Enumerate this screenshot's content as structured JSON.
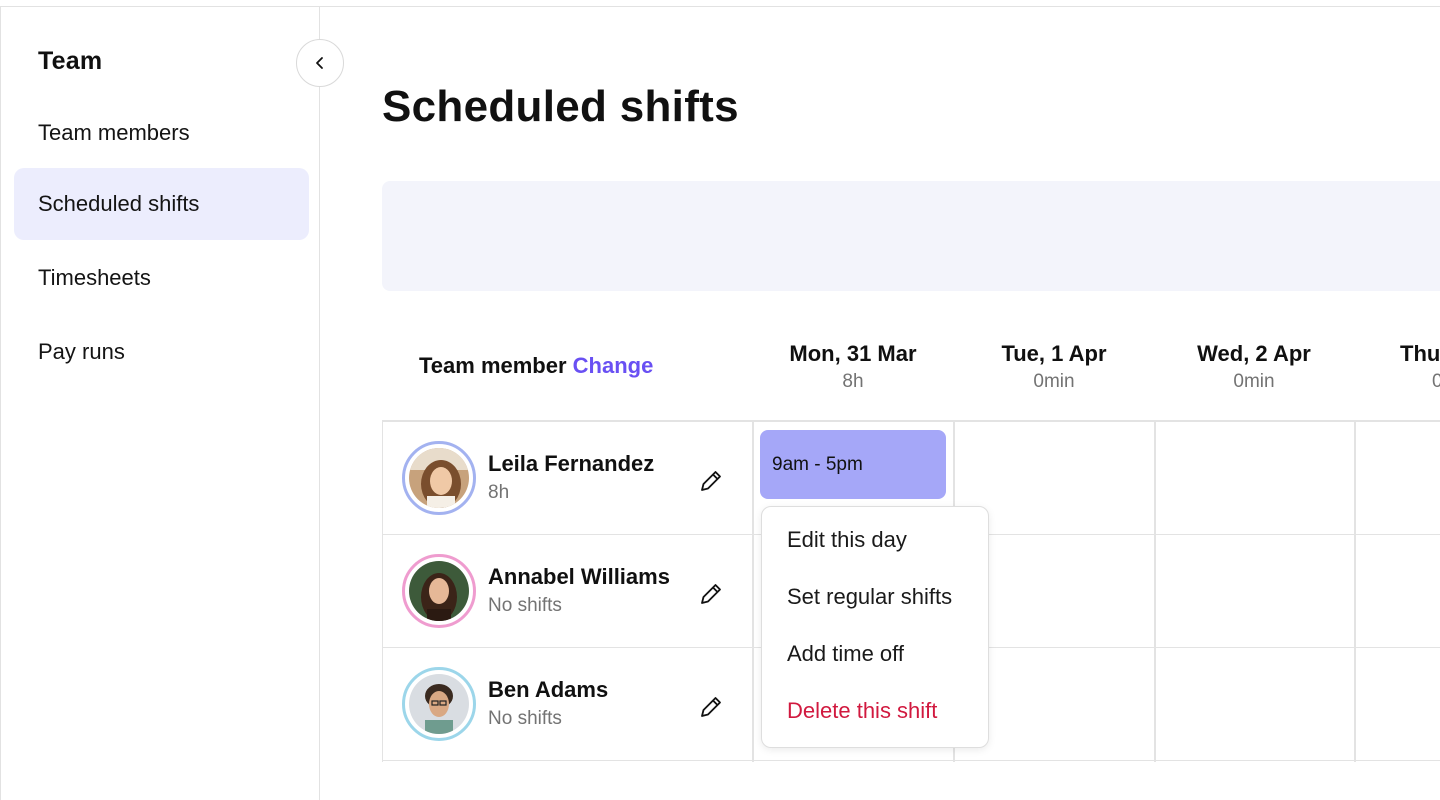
{
  "sidebar": {
    "title": "Team",
    "items": [
      {
        "label": "Team members",
        "active": false
      },
      {
        "label": "Scheduled shifts",
        "active": true
      },
      {
        "label": "Timesheets",
        "active": false
      },
      {
        "label": "Pay runs",
        "active": false
      }
    ],
    "collapse_icon": "chevron-left-icon"
  },
  "main": {
    "title": "Scheduled shifts",
    "grid": {
      "member_header": "Team member",
      "change_link": "Change",
      "days": [
        {
          "label": "Mon, 31 Mar",
          "hours": "8h"
        },
        {
          "label": "Tue, 1 Apr",
          "hours": "0min"
        },
        {
          "label": "Wed, 2 Apr",
          "hours": "0min"
        },
        {
          "label": "Thu",
          "hours": "0"
        }
      ],
      "members": [
        {
          "name": "Leila Fernandez",
          "sub": "8h",
          "ring_color": "#a3b2f0"
        },
        {
          "name": "Annabel Williams",
          "sub": "No shifts",
          "ring_color": "#ef9ccf"
        },
        {
          "name": "Ben Adams",
          "sub": "No shifts",
          "ring_color": "#9cd6ea"
        }
      ],
      "shift": {
        "label": "9am - 5pm",
        "color": "#a5a7f8"
      }
    },
    "context_menu": {
      "items": [
        {
          "label": "Edit this day",
          "danger": false
        },
        {
          "label": "Set regular shifts",
          "danger": false
        },
        {
          "label": "Add time off",
          "danger": false
        },
        {
          "label": "Delete this shift",
          "danger": true
        }
      ]
    }
  },
  "colors": {
    "accent": "#6950f3",
    "active_nav_bg": "#ecedfd",
    "danger": "#d1193f"
  }
}
